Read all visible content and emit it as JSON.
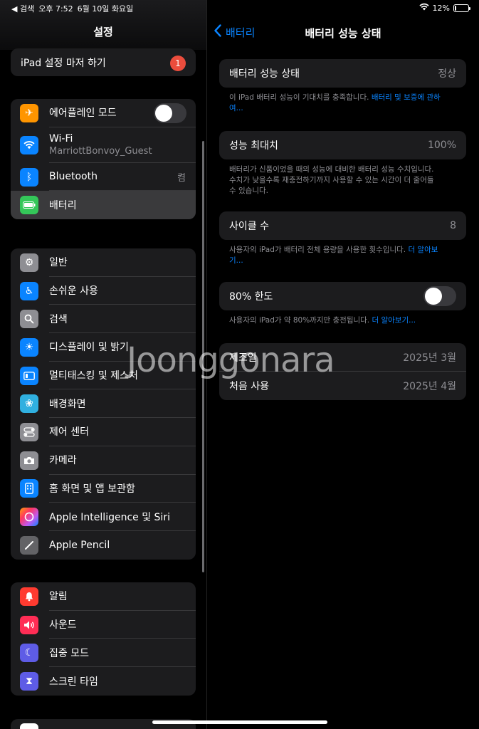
{
  "status": {
    "back_label": "◀ 검색",
    "time": "오후 7:52",
    "date": "6월 10일 화요일",
    "battery_percent": "12%",
    "battery_level": 0.12
  },
  "sidebar": {
    "title": "설정",
    "setup": {
      "label": "iPad 설정 마저 하기",
      "badge": "1"
    },
    "group1": [
      {
        "label": "에어플레인 모드",
        "icon": "airplane-icon",
        "color": "#ff9500",
        "toggle_on": false
      },
      {
        "label": "Wi-Fi",
        "sub": "MarriottBonvoy_Guest",
        "icon": "wifi-icon",
        "color": "#0a84ff"
      },
      {
        "label": "Bluetooth",
        "value": "켬",
        "icon": "bluetooth-icon",
        "color": "#0a84ff"
      },
      {
        "label": "배터리",
        "icon": "battery-icon",
        "color": "#34c759",
        "selected": true
      }
    ],
    "group2": [
      {
        "label": "일반",
        "icon": "gear-icon",
        "color": "#8e8e93"
      },
      {
        "label": "손쉬운 사용",
        "icon": "accessibility-icon",
        "color": "#0a84ff"
      },
      {
        "label": "검색",
        "icon": "search-icon",
        "color": "#8e8e93"
      },
      {
        "label": "디스플레이 및 밝기",
        "icon": "sun-icon",
        "color": "#0a84ff"
      },
      {
        "label": "멀티태스킹 및 제스처",
        "icon": "multitasking-icon",
        "color": "#0a84ff"
      },
      {
        "label": "배경화면",
        "icon": "flower-icon",
        "color": "#30b0e0"
      },
      {
        "label": "제어 센터",
        "icon": "control-center-icon",
        "color": "#8e8e93"
      },
      {
        "label": "카메라",
        "icon": "camera-icon",
        "color": "#8e8e93"
      },
      {
        "label": "홈 화면 및 앱 보관함",
        "icon": "home-screen-icon",
        "color": "#0a84ff"
      },
      {
        "label": "Apple Intelligence 및 Siri",
        "icon": "siri-icon",
        "color": "#2c2c2e"
      },
      {
        "label": "Apple Pencil",
        "icon": "pencil-icon",
        "color": "#636366"
      }
    ],
    "group3": [
      {
        "label": "알림",
        "icon": "bell-icon",
        "color": "#ff3b30"
      },
      {
        "label": "사운드",
        "icon": "speaker-icon",
        "color": "#ff2d55"
      },
      {
        "label": "집중 모드",
        "icon": "moon-icon",
        "color": "#5e5ce6"
      },
      {
        "label": "스크린 타임",
        "icon": "hourglass-icon",
        "color": "#5e5ce6"
      }
    ]
  },
  "detail": {
    "back": "배터리",
    "title": "배터리 성능 상태",
    "health_row": {
      "label": "배터리 성능 상태",
      "value": "정상"
    },
    "health_note": "이 iPad 배터리 성능이 기대치를 충족합니다. ",
    "health_link": "배터리 및 보증에 관하여...",
    "max_row": {
      "label": "성능 최대치",
      "value": "100%"
    },
    "max_note": "배터리가 신품이었을 때의 성능에 대비한 배터리 성능 수치입니다. 수치가 낮을수록 재충전하기까지 사용할 수 있는 시간이 더 줄어들 수 있습니다.",
    "cycle_row": {
      "label": "사이클 수",
      "value": "8"
    },
    "cycle_note": "사용자의 iPad가 배터리 전체 용량을 사용한 횟수입니다. ",
    "cycle_link": "더 알아보기...",
    "limit_row": {
      "label": "80% 한도",
      "toggle_on": false
    },
    "limit_note": "사용자의 iPad가 약 80%까지만 충전됩니다. ",
    "limit_link": "더 알아보기...",
    "manufacture": {
      "label": "제조일",
      "value": "2025년 3월"
    },
    "first_use": {
      "label": "처음 사용",
      "value": "2025년 4월"
    }
  },
  "watermark": "Joonggonara"
}
